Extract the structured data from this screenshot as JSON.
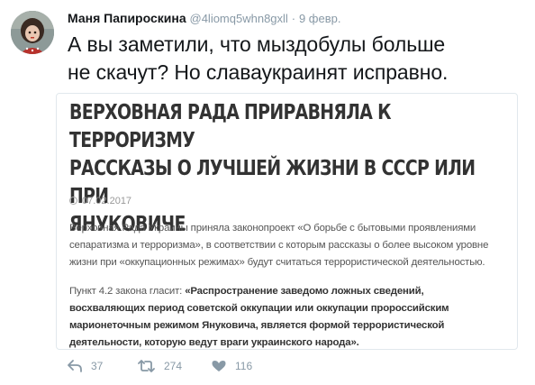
{
  "tweet": {
    "author_name": "Маня Папироскина",
    "author_handle": "@4liomq5whn8gxll",
    "separator": "·",
    "date": "9 февр.",
    "text_line1": "А вы заметили, что мыздобулы больше",
    "text_line2": "не скачут? Но славаукраинят исправно."
  },
  "card": {
    "headline_line1": "ВЕРХОВНАЯ РАДА ПРИРАВНЯЛА К ТЕРРОРИЗМУ",
    "headline_line2": "РАССКАЗЫ О ЛУЧШЕЙ ЖИЗНИ В СССР ИЛИ ПРИ",
    "headline_line3": "ЯНУКОВИЧЕ",
    "date": "07.02.2017",
    "para1_line1": "Верховная Рада Украины приняла законопроект «О борьбе с бытовыми проявлениями",
    "para1_line2": "сепаратизма и терроризма», в соответствии с которым рассказы о более высоком уровне",
    "para1_line3": "жизни при «оккупационных режимах» будут считаться террористической деятельностью.",
    "para2_intro": "Пункт 4.2 закона гласит: ",
    "para2_line1": "«Распространение заведомо ложных сведений,",
    "para2_line2": "восхваляющих период советской оккупации или оккупации пророссийским",
    "para2_line3": "марионеточным режимом Януковича, является формой террористической",
    "para2_line4": "деятельности, которую ведут враги украинского народа»."
  },
  "actions": {
    "reply_icon": "reply-icon",
    "reply_count": "37",
    "retweet_icon": "retweet-icon",
    "retweet_count": "274",
    "like_icon": "heart-icon",
    "like_count": "116",
    "icon_color": "#8899a6"
  }
}
